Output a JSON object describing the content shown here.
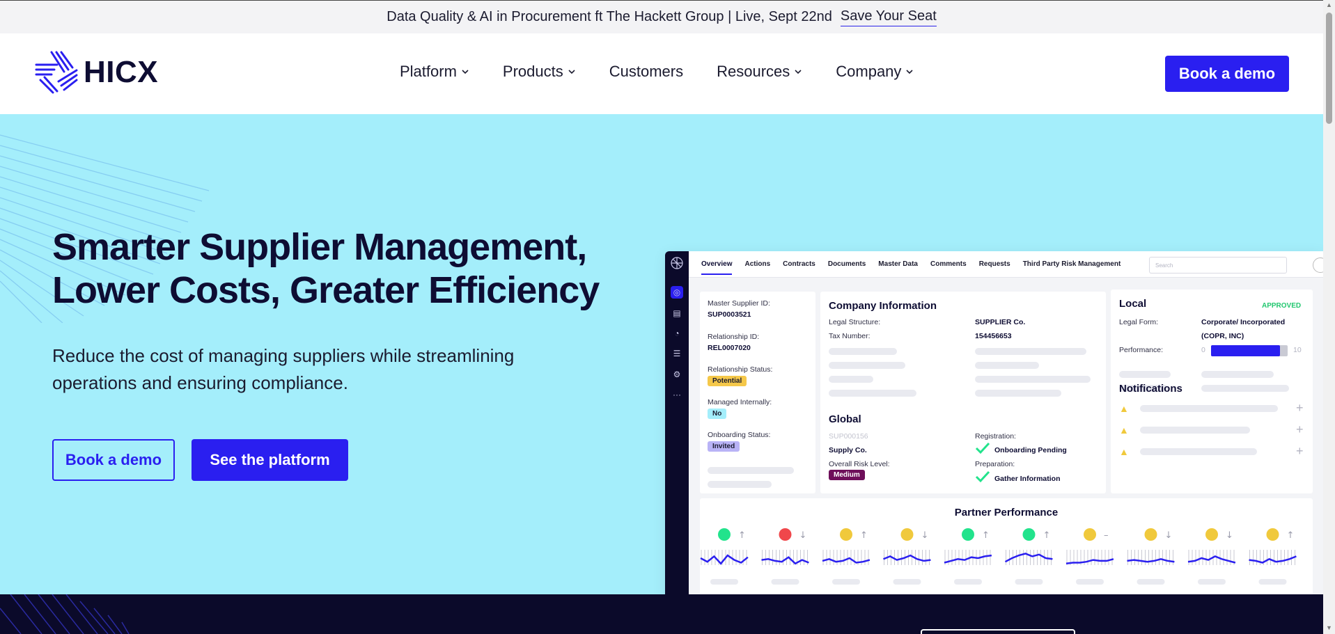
{
  "banner": {
    "text": "Data Quality & AI in Procurement ft The Hackett Group | Live, Sept 22nd",
    "cta": "Save Your Seat"
  },
  "nav": {
    "logo_text": "HICX",
    "items": [
      "Platform",
      "Products",
      "Customers",
      "Resources",
      "Company"
    ],
    "cta": "Book a demo"
  },
  "hero": {
    "title_line1": "Smarter Supplier Management,",
    "title_line2": "Lower Costs, Greater Efficiency",
    "subtitle": "Reduce the cost of managing suppliers while streamlining operations and ensuring compliance.",
    "btn_primary": "Book a demo",
    "btn_secondary": "See the platform",
    "bg_color": "#a4eefb",
    "accent": "#2a1ff0"
  },
  "app": {
    "tabs": [
      "Overview",
      "Actions",
      "Contracts",
      "Documents",
      "Master Data",
      "Comments",
      "Requests",
      "Third Party Risk Management"
    ],
    "search_placeholder": "Search",
    "left": {
      "master_id_label": "Master Supplier ID:",
      "master_id": "SUP0003521",
      "rel_id_label": "Relationship ID:",
      "rel_id": "REL0007020",
      "rel_status_label": "Relationship Status:",
      "rel_status": "Potential",
      "managed_label": "Managed Internally:",
      "managed": "No",
      "onboarding_label": "Onboarding Status:",
      "onboarding": "Invited"
    },
    "company": {
      "title": "Company Information",
      "legal_structure_label": "Legal Structure:",
      "legal_structure": "SUPPLIER Co.",
      "tax_label": "Tax Number:",
      "tax": "154456653"
    },
    "local": {
      "title": "Local",
      "status": "APPROVED",
      "legal_form_label": "Legal Form:",
      "legal_form_1": "Corporate/ Incorporated",
      "legal_form_2": "(COPR, INC)",
      "performance_label": "Performance:",
      "perf_min": "0",
      "perf_max": "10",
      "performance_value": 0.9
    },
    "global": {
      "title": "Global",
      "sup_id": "SUP000156",
      "name": "Supply Co.",
      "risk_label": "Overall Risk Level:",
      "risk": "Medium",
      "registration_label": "Registration:",
      "registration": "Onboarding Pending",
      "preparation_label": "Preparation:",
      "preparation": "Gather Information"
    },
    "notifications": {
      "title": "Notifications"
    },
    "partner": {
      "title": "Partner Performance",
      "items": [
        {
          "color": "#22e38c",
          "trend": "↑"
        },
        {
          "color": "#f0474b",
          "trend": "↓"
        },
        {
          "color": "#f0c93c",
          "trend": "↑"
        },
        {
          "color": "#f0c93c",
          "trend": "↓"
        },
        {
          "color": "#22e38c",
          "trend": "↑"
        },
        {
          "color": "#22e38c",
          "trend": "↑"
        },
        {
          "color": "#f0c93c",
          "trend": "–"
        },
        {
          "color": "#f0c93c",
          "trend": "↓"
        },
        {
          "color": "#f0c93c",
          "trend": "↓"
        },
        {
          "color": "#f0c93c",
          "trend": "↑"
        }
      ]
    }
  }
}
